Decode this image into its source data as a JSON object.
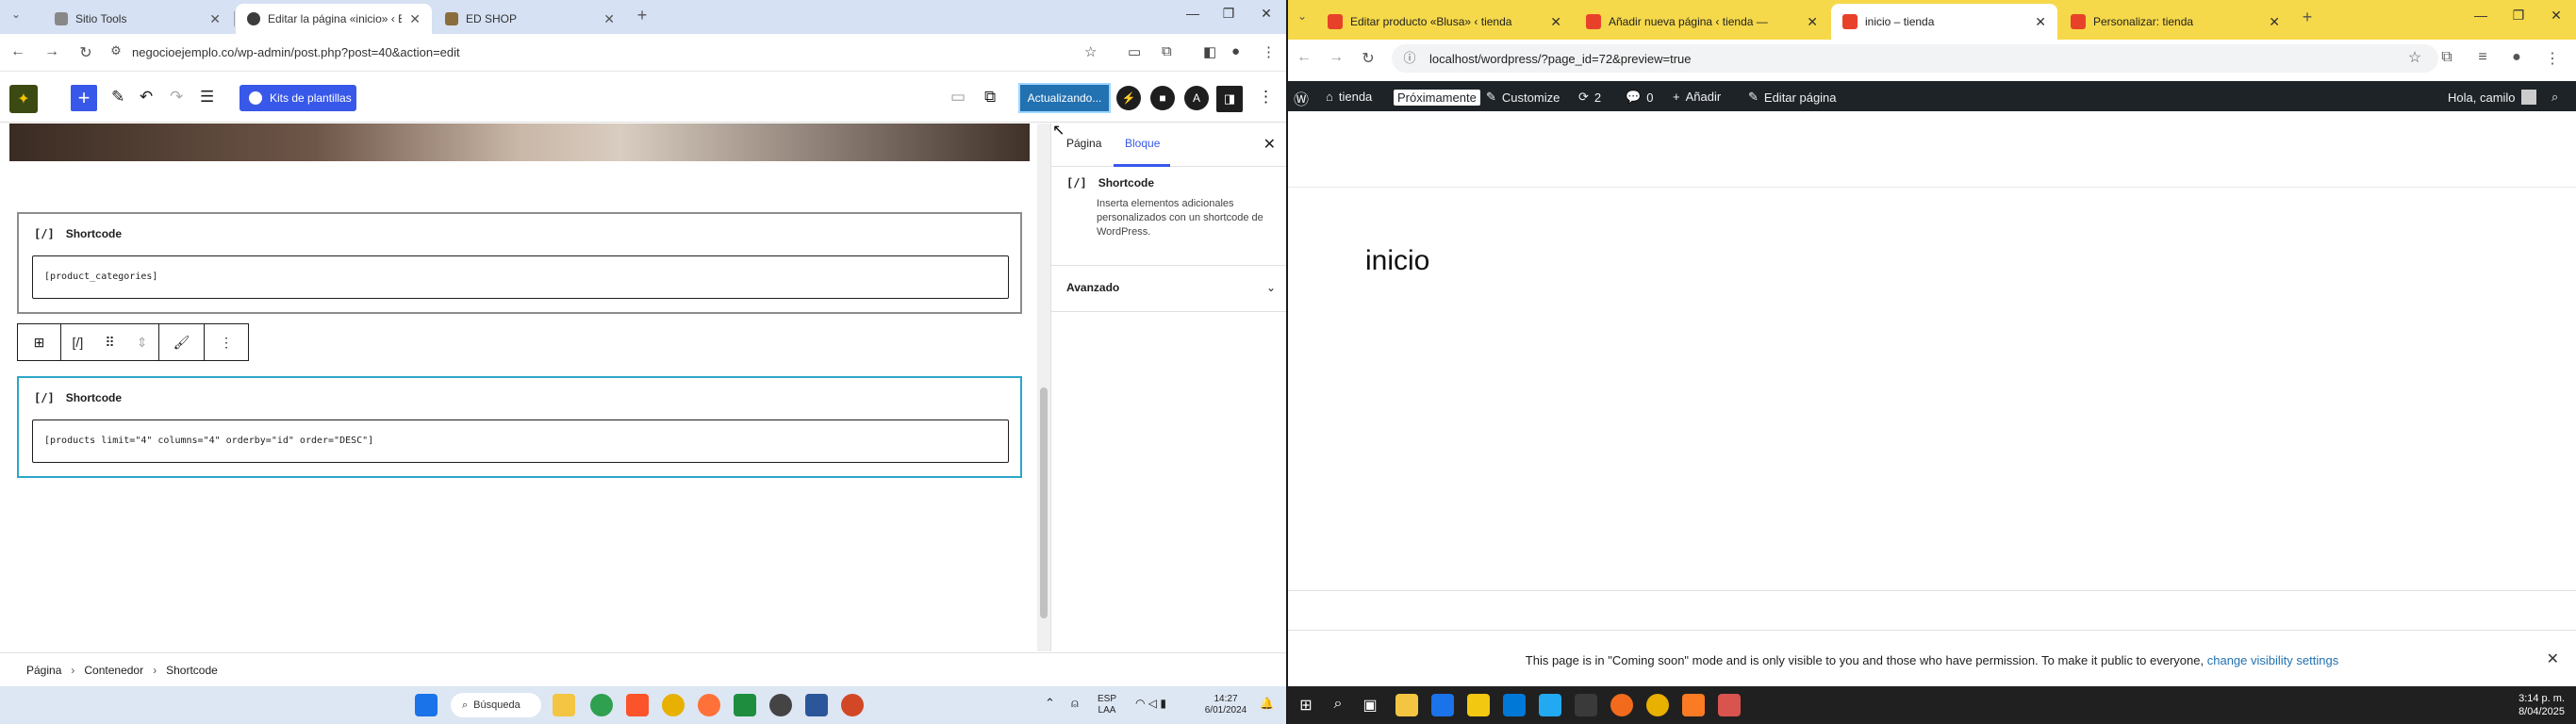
{
  "left": {
    "tabs": [
      {
        "title": "Sitio Tools",
        "favicon_color": "#888888",
        "active": false
      },
      {
        "title": "Editar la página «inicio» ‹ ED S",
        "favicon_color": "#3c3c3c",
        "active": true
      },
      {
        "title": "ED SHOP",
        "favicon_color": "#8a6d3b",
        "active": false
      }
    ],
    "address": {
      "url": "negocioejemplo.co/wp-admin/post.php?post=40&action=edit"
    },
    "toolbar": {
      "kits_label": "Kits de plantillas",
      "update_label": "Actualizando...",
      "icons": [
        "add-block",
        "pencil",
        "undo",
        "redo",
        "list-view",
        "preview",
        "external-link",
        "hostinger",
        "square-logo",
        "a-logo",
        "settings-panel",
        "more-options"
      ]
    },
    "blocks": [
      {
        "name": "Shortcode",
        "value": "[product_categories]"
      },
      {
        "name": "Shortcode",
        "value": "[products limit=\"4\" columns=\"4\" orderby=\"id\" order=\"DESC\"]"
      }
    ],
    "breadcrumb": [
      "Página",
      "Contenedor",
      "Shortcode"
    ],
    "sidebar": {
      "tab_page": "Página",
      "tab_block": "Bloque",
      "block_name": "Shortcode",
      "block_desc": "Inserta elementos adicionales personalizados con un shortcode de WordPress.",
      "advanced": "Avanzado"
    },
    "taskbar": {
      "search": "Búsqueda",
      "lang": "ESP",
      "lang2": "LAA",
      "time": "14:27",
      "date": "6/01/2024"
    }
  },
  "right": {
    "tabs": [
      {
        "title": "Editar producto «Blusa» ‹ tienda",
        "active": false
      },
      {
        "title": "Añadir nueva página ‹ tienda —",
        "active": false
      },
      {
        "title": "inicio – tienda",
        "active": true
      },
      {
        "title": "Personalizar: tienda",
        "active": false
      }
    ],
    "url": "localhost/wordpress/?page_id=72&preview=true",
    "adminbar": {
      "site": "tienda",
      "soon": "Próximamente",
      "customize": "Customize",
      "updates": "2",
      "comments": "0",
      "add": "Añadir",
      "edit": "Editar página",
      "greeting": "Hola, camilo"
    },
    "page_title": "inicio",
    "notice": {
      "text": "This page is in \"Coming soon\" mode and is only visible to you and those who have permission. To make it public to everyone,",
      "link": "change visibility settings"
    },
    "taskbar": {
      "time": "3:14 p. m.",
      "date": "8/04/2025"
    }
  },
  "colors": {
    "wp_blue": "#3858e9",
    "admin_bar": "#1d2327",
    "right_tabbar": "#f6d94a",
    "left_tabbar": "#d6e1f3"
  }
}
